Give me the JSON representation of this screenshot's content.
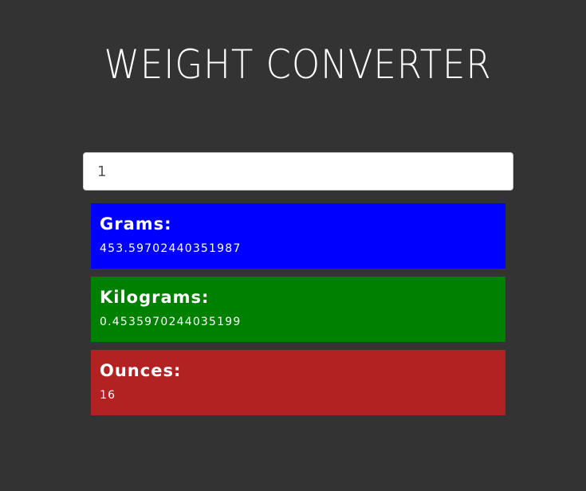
{
  "app": {
    "title": "WEIGHT CONVERTER"
  },
  "input": {
    "value": "1",
    "placeholder": ""
  },
  "results": [
    {
      "label": "Grams:",
      "value": "453.59702440351987",
      "color": "#0000ff"
    },
    {
      "label": "Kilograms:",
      "value": "0.4535970244035199",
      "color": "#008000"
    },
    {
      "label": "Ounces:",
      "value": "16",
      "color": "#b22222"
    }
  ]
}
